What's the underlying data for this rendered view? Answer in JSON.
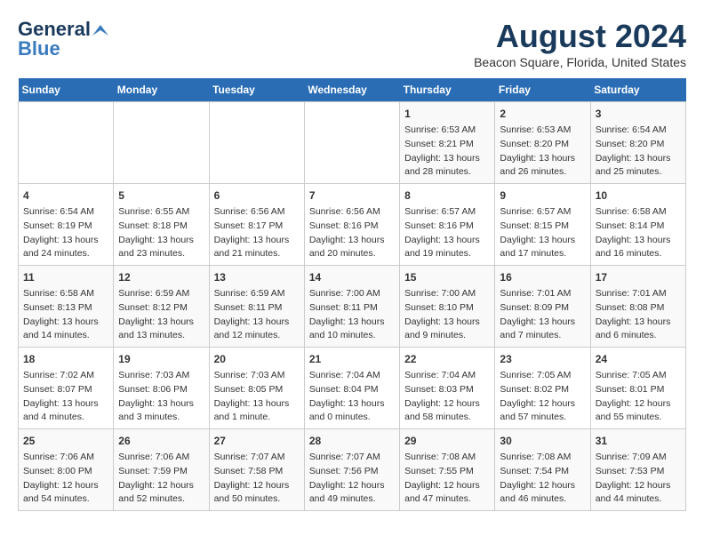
{
  "header": {
    "logo_line1": "General",
    "logo_line2": "Blue",
    "title": "August 2024",
    "subtitle": "Beacon Square, Florida, United States"
  },
  "days_of_week": [
    "Sunday",
    "Monday",
    "Tuesday",
    "Wednesday",
    "Thursday",
    "Friday",
    "Saturday"
  ],
  "weeks": [
    [
      {
        "day": "",
        "content": ""
      },
      {
        "day": "",
        "content": ""
      },
      {
        "day": "",
        "content": ""
      },
      {
        "day": "",
        "content": ""
      },
      {
        "day": "1",
        "content": "Sunrise: 6:53 AM\nSunset: 8:21 PM\nDaylight: 13 hours and 28 minutes."
      },
      {
        "day": "2",
        "content": "Sunrise: 6:53 AM\nSunset: 8:20 PM\nDaylight: 13 hours and 26 minutes."
      },
      {
        "day": "3",
        "content": "Sunrise: 6:54 AM\nSunset: 8:20 PM\nDaylight: 13 hours and 25 minutes."
      }
    ],
    [
      {
        "day": "4",
        "content": "Sunrise: 6:54 AM\nSunset: 8:19 PM\nDaylight: 13 hours and 24 minutes."
      },
      {
        "day": "5",
        "content": "Sunrise: 6:55 AM\nSunset: 8:18 PM\nDaylight: 13 hours and 23 minutes."
      },
      {
        "day": "6",
        "content": "Sunrise: 6:56 AM\nSunset: 8:17 PM\nDaylight: 13 hours and 21 minutes."
      },
      {
        "day": "7",
        "content": "Sunrise: 6:56 AM\nSunset: 8:16 PM\nDaylight: 13 hours and 20 minutes."
      },
      {
        "day": "8",
        "content": "Sunrise: 6:57 AM\nSunset: 8:16 PM\nDaylight: 13 hours and 19 minutes."
      },
      {
        "day": "9",
        "content": "Sunrise: 6:57 AM\nSunset: 8:15 PM\nDaylight: 13 hours and 17 minutes."
      },
      {
        "day": "10",
        "content": "Sunrise: 6:58 AM\nSunset: 8:14 PM\nDaylight: 13 hours and 16 minutes."
      }
    ],
    [
      {
        "day": "11",
        "content": "Sunrise: 6:58 AM\nSunset: 8:13 PM\nDaylight: 13 hours and 14 minutes."
      },
      {
        "day": "12",
        "content": "Sunrise: 6:59 AM\nSunset: 8:12 PM\nDaylight: 13 hours and 13 minutes."
      },
      {
        "day": "13",
        "content": "Sunrise: 6:59 AM\nSunset: 8:11 PM\nDaylight: 13 hours and 12 minutes."
      },
      {
        "day": "14",
        "content": "Sunrise: 7:00 AM\nSunset: 8:11 PM\nDaylight: 13 hours and 10 minutes."
      },
      {
        "day": "15",
        "content": "Sunrise: 7:00 AM\nSunset: 8:10 PM\nDaylight: 13 hours and 9 minutes."
      },
      {
        "day": "16",
        "content": "Sunrise: 7:01 AM\nSunset: 8:09 PM\nDaylight: 13 hours and 7 minutes."
      },
      {
        "day": "17",
        "content": "Sunrise: 7:01 AM\nSunset: 8:08 PM\nDaylight: 13 hours and 6 minutes."
      }
    ],
    [
      {
        "day": "18",
        "content": "Sunrise: 7:02 AM\nSunset: 8:07 PM\nDaylight: 13 hours and 4 minutes."
      },
      {
        "day": "19",
        "content": "Sunrise: 7:03 AM\nSunset: 8:06 PM\nDaylight: 13 hours and 3 minutes."
      },
      {
        "day": "20",
        "content": "Sunrise: 7:03 AM\nSunset: 8:05 PM\nDaylight: 13 hours and 1 minute."
      },
      {
        "day": "21",
        "content": "Sunrise: 7:04 AM\nSunset: 8:04 PM\nDaylight: 13 hours and 0 minutes."
      },
      {
        "day": "22",
        "content": "Sunrise: 7:04 AM\nSunset: 8:03 PM\nDaylight: 12 hours and 58 minutes."
      },
      {
        "day": "23",
        "content": "Sunrise: 7:05 AM\nSunset: 8:02 PM\nDaylight: 12 hours and 57 minutes."
      },
      {
        "day": "24",
        "content": "Sunrise: 7:05 AM\nSunset: 8:01 PM\nDaylight: 12 hours and 55 minutes."
      }
    ],
    [
      {
        "day": "25",
        "content": "Sunrise: 7:06 AM\nSunset: 8:00 PM\nDaylight: 12 hours and 54 minutes."
      },
      {
        "day": "26",
        "content": "Sunrise: 7:06 AM\nSunset: 7:59 PM\nDaylight: 12 hours and 52 minutes."
      },
      {
        "day": "27",
        "content": "Sunrise: 7:07 AM\nSunset: 7:58 PM\nDaylight: 12 hours and 50 minutes."
      },
      {
        "day": "28",
        "content": "Sunrise: 7:07 AM\nSunset: 7:56 PM\nDaylight: 12 hours and 49 minutes."
      },
      {
        "day": "29",
        "content": "Sunrise: 7:08 AM\nSunset: 7:55 PM\nDaylight: 12 hours and 47 minutes."
      },
      {
        "day": "30",
        "content": "Sunrise: 7:08 AM\nSunset: 7:54 PM\nDaylight: 12 hours and 46 minutes."
      },
      {
        "day": "31",
        "content": "Sunrise: 7:09 AM\nSunset: 7:53 PM\nDaylight: 12 hours and 44 minutes."
      }
    ]
  ]
}
